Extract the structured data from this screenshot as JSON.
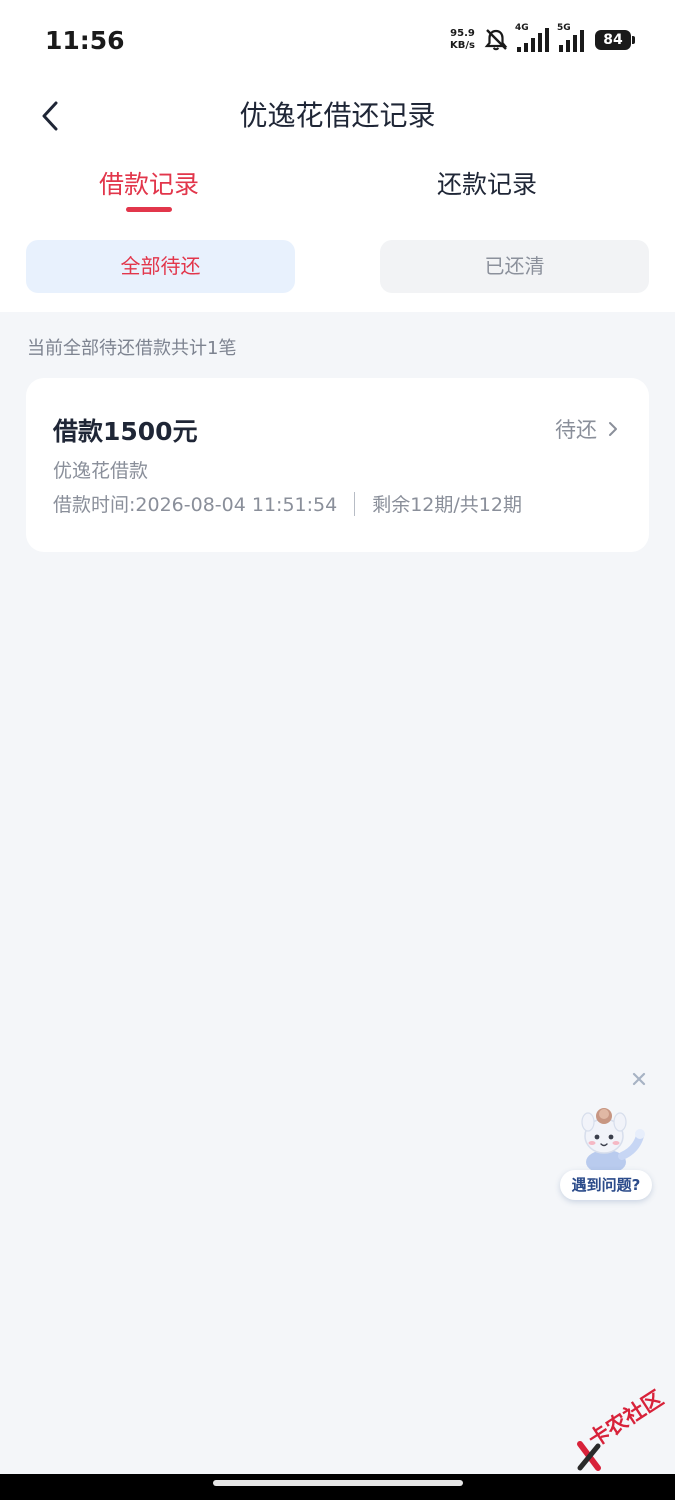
{
  "status_bar": {
    "time": "11:56",
    "net_speed_value": "95.9",
    "net_speed_unit": "KB/s",
    "mute_icon": "bell-off-icon",
    "signal_4g_label": "4G",
    "signal_5g_label": "5G",
    "battery": "84"
  },
  "header": {
    "back_icon": "chevron-left-icon",
    "title": "优逸花借还记录"
  },
  "tabs": [
    {
      "label": "借款记录",
      "active": true
    },
    {
      "label": "还款记录",
      "active": false
    }
  ],
  "filters": [
    {
      "label": "全部待还",
      "active": true
    },
    {
      "label": "已还清",
      "active": false
    }
  ],
  "summary": "当前全部待还借款共计1笔",
  "loans": [
    {
      "amount": "借款1500元",
      "status": "待还",
      "product": "优逸花借款",
      "time": "借款时间:2026-08-04 11:51:54",
      "periods": "剩余12期/共12期"
    }
  ],
  "helper": {
    "label": "遇到问题?",
    "close_icon": "close-icon",
    "mascot_icon": "mascot-icon"
  },
  "watermark": {
    "text": "卡农社区",
    "logo_icon": "kanong-logo-icon"
  },
  "colors": {
    "accent": "#e2364b",
    "background": "#f4f6f9",
    "filter_active_bg": "#e8f1fd"
  }
}
